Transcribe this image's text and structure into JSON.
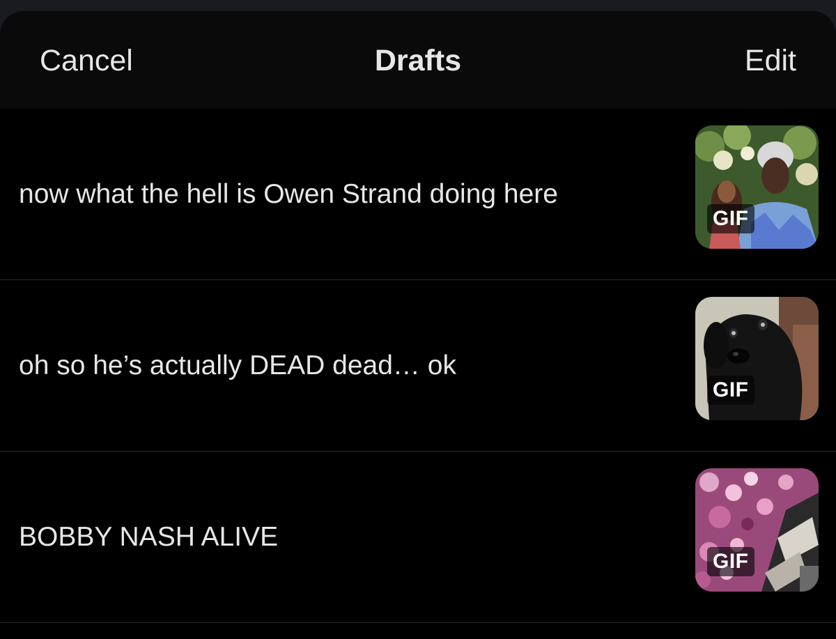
{
  "nav": {
    "cancel_label": "Cancel",
    "title": "Drafts",
    "edit_label": "Edit"
  },
  "drafts": [
    {
      "text": "now what the hell is Owen Strand doing here",
      "badge": "GIF",
      "thumb_icon": "gif-thumbnail-women-icon"
    },
    {
      "text": "oh so he’s actually DEAD dead… ok",
      "badge": "GIF",
      "thumb_icon": "gif-thumbnail-dog-icon"
    },
    {
      "text": "BOBBY NASH ALIVE",
      "badge": "GIF",
      "thumb_icon": "gif-thumbnail-confetti-icon"
    }
  ],
  "colors": {
    "background": "#000000",
    "header": "#0a0a0b",
    "text": "#e7e7e7",
    "divider": "#2a2a2c"
  }
}
